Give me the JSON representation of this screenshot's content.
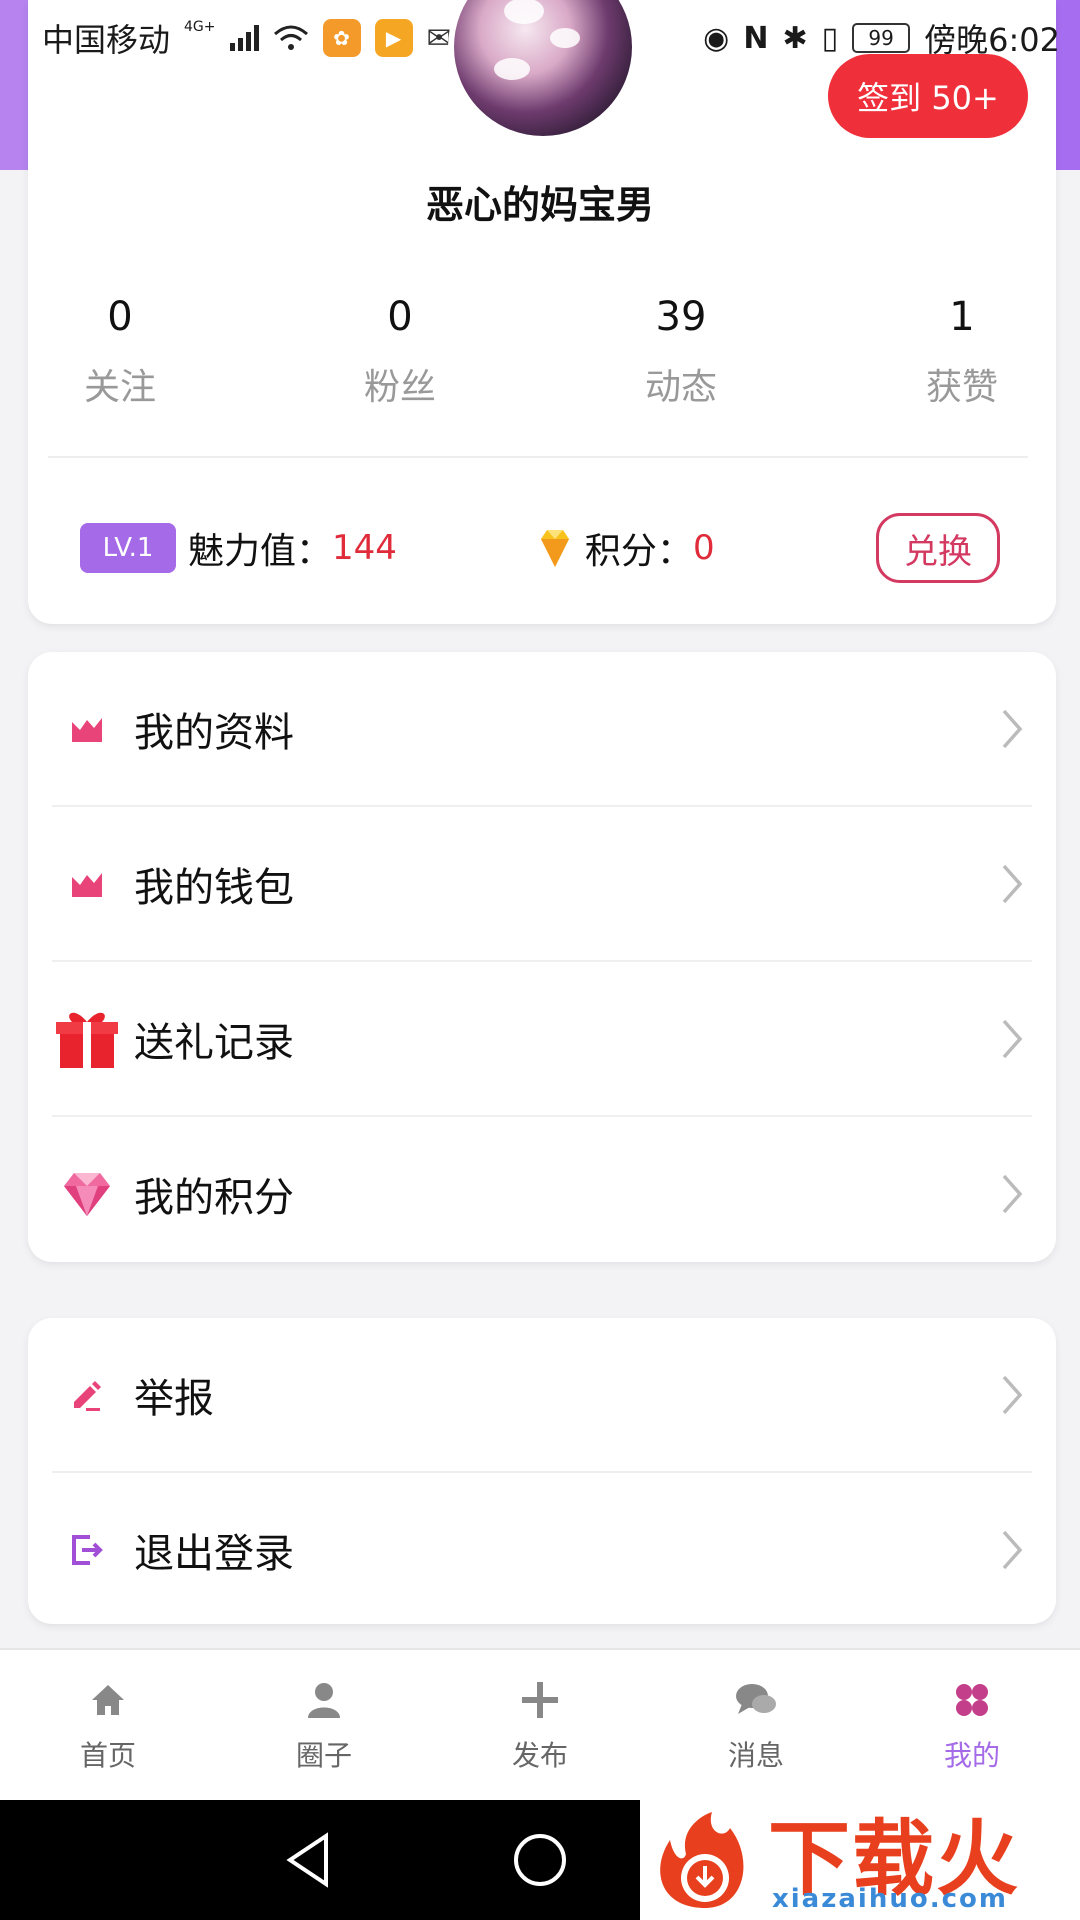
{
  "status_bar": {
    "carrier": "中国移动",
    "network": "4G+",
    "battery": "99",
    "time": "傍晚6:02",
    "app_icons": [
      "uc-browser-icon",
      "video-icon",
      "wechat-icon",
      "alipay-icon",
      "zhihu-icon"
    ]
  },
  "profile": {
    "nickname": "恶心的妈宝男",
    "checkin_label": "签到 50+",
    "stats": [
      {
        "value": "0",
        "label": "关注"
      },
      {
        "value": "0",
        "label": "粉丝"
      },
      {
        "value": "39",
        "label": "动态"
      },
      {
        "value": "1",
        "label": "获赞"
      }
    ],
    "level_badge": "LV.1",
    "charm_label": "魅力值：",
    "charm_value": "144",
    "points_label": "积分：",
    "points_value": "0",
    "exchange_label": "兑换"
  },
  "menu_group_1": [
    {
      "label": "我的资料",
      "icon": "chart-icon"
    },
    {
      "label": "我的钱包",
      "icon": "chart-icon"
    },
    {
      "label": "送礼记录",
      "icon": "gift-icon"
    },
    {
      "label": "我的积分",
      "icon": "diamond-icon"
    }
  ],
  "menu_group_2": [
    {
      "label": "举报",
      "icon": "pencil-icon"
    },
    {
      "label": "退出登录",
      "icon": "logout-icon"
    }
  ],
  "tabbar": {
    "items": [
      {
        "label": "首页",
        "icon": "home-icon"
      },
      {
        "label": "圈子",
        "icon": "person-icon"
      },
      {
        "label": "发布",
        "icon": "plus-icon"
      },
      {
        "label": "消息",
        "icon": "chat-icon"
      },
      {
        "label": "我的",
        "icon": "clover-icon"
      }
    ],
    "active_index": 4
  },
  "watermark": {
    "title": "下载火",
    "url": "xiazaihuo.com"
  },
  "colors": {
    "header_purple": "#a66df0",
    "accent_purple": "#a46ae8",
    "checkin_red": "#ef2f3a",
    "value_red": "#e02b3a",
    "exchange_pink": "#d33961"
  }
}
